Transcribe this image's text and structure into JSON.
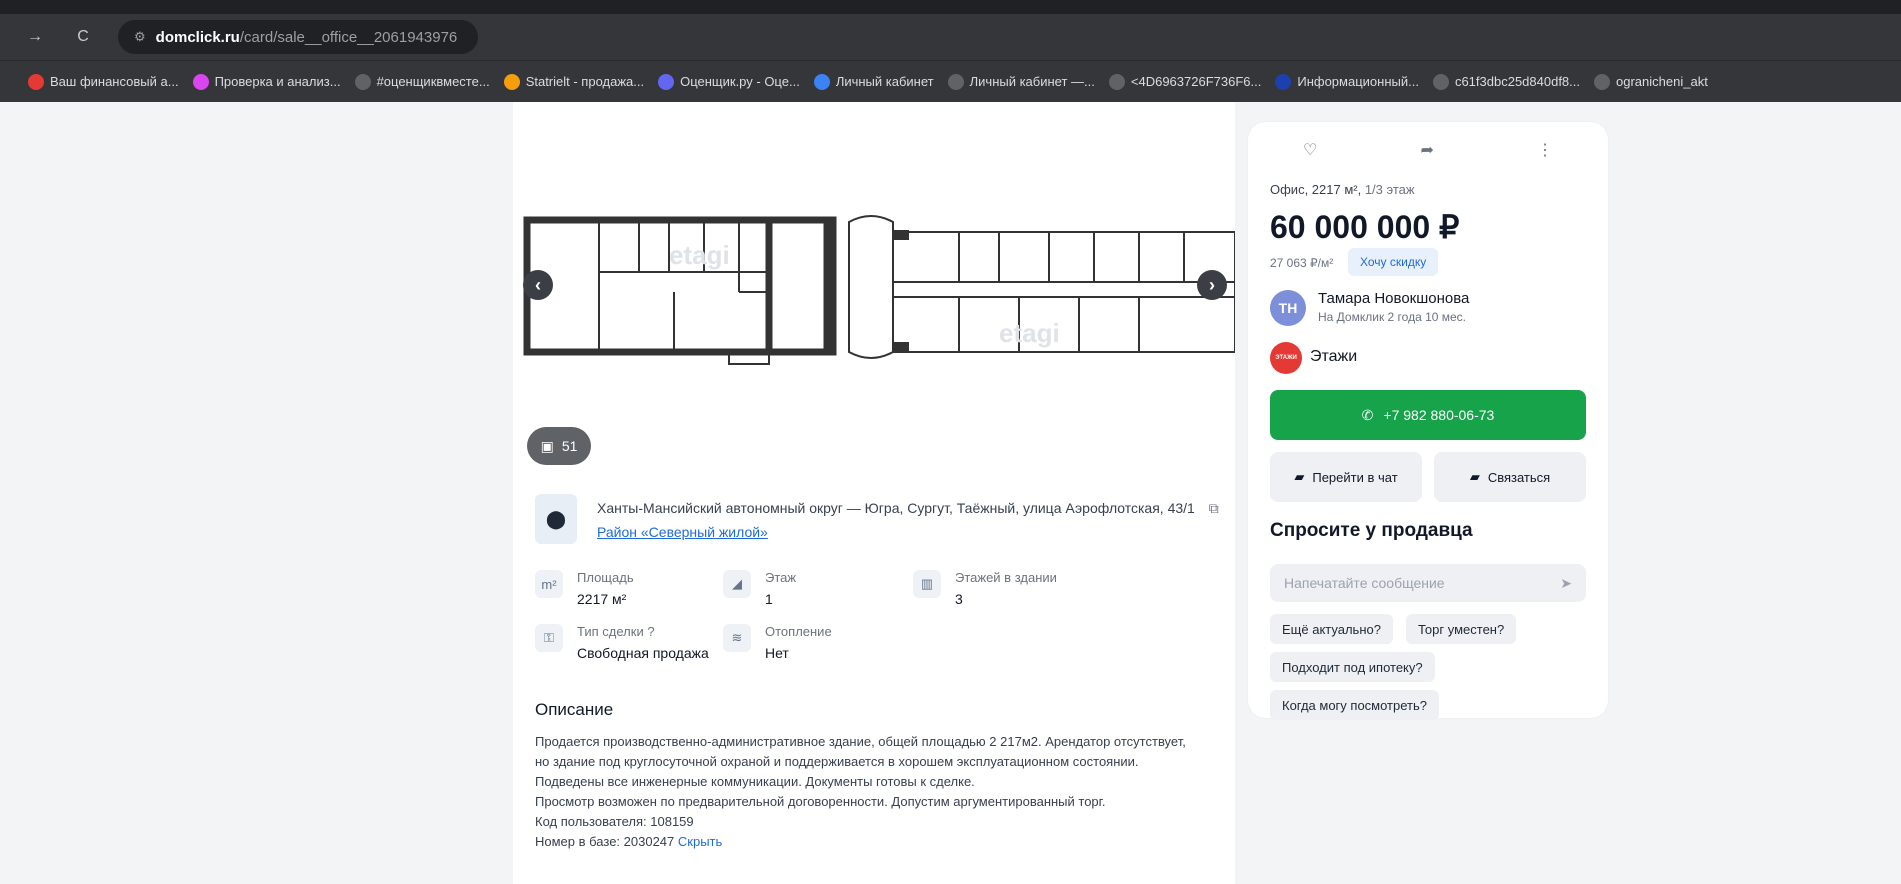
{
  "browser": {
    "url_host": "domclick.ru",
    "url_path": "/card/sale__office__2061943976",
    "bookmarks": [
      {
        "label": "Ваш финансовый а...",
        "color": "#e53935",
        "icon": "ri"
      },
      {
        "label": "Проверка и анализ...",
        "color": "#d946ef",
        "icon": "p"
      },
      {
        "label": "#оценщиквместе...",
        "color": "#5f6368",
        "icon": "globe"
      },
      {
        "label": "Statrielt - продажа...",
        "color": "#f59e0b",
        "icon": "st"
      },
      {
        "label": "Оценщик.ру - Оце...",
        "color": "#6366f1",
        "icon": "star"
      },
      {
        "label": "Личный кабинет",
        "color": "#3b82f6",
        "icon": "lk"
      },
      {
        "label": "Личный кабинет —...",
        "color": "#5f6368",
        "icon": "globe"
      },
      {
        "label": "<4D6963726F736F6...",
        "color": "#5f6368",
        "icon": "globe"
      },
      {
        "label": "Информационный...",
        "color": "#1e40af",
        "icon": "info"
      },
      {
        "label": "c61f3dbc25d840df8...",
        "color": "#5f6368",
        "icon": "globe"
      },
      {
        "label": "ogranicheni_akt",
        "color": "#5f6368",
        "icon": "globe"
      }
    ]
  },
  "gallery": {
    "photo_count": "51",
    "watermark": "etagi"
  },
  "location": {
    "address": "Ханты-Мансийский автономный округ — Югра, Сургут, Таёжный, улица Аэрофлотская, 43/1",
    "district": "Район «Северный жилой»"
  },
  "props": {
    "area_label": "Площадь",
    "area_value": "2217 м²",
    "floor_label": "Этаж",
    "floor_value": "1",
    "floors_label": "Этажей в здании",
    "floors_value": "3",
    "deal_label": "Тип сделки",
    "deal_value": "Свободная продажа",
    "heating_label": "Отопление",
    "heating_value": "Нет"
  },
  "description": {
    "title": "Описание",
    "line1": "Продается производственно-административное здание, общей площадью 2 217м2. Арендатор отсутствует, но здание под круглосуточной охраной и поддерживается в хорошем эксплуатационном состоянии.",
    "line2": "Подведены все инженерные коммуникации. Документы готовы к сделке.",
    "line3": "Просмотр возможен по предварительной договоренности. Допустим аргументированный торг.",
    "user_code": "Код пользователя: 108159",
    "base_number": "Номер в базе: 2030247",
    "hide_link": "Скрыть"
  },
  "offer": {
    "type": "Офис, 2217 м²,",
    "floor": "1/3 этаж",
    "price": "60 000 000 ₽",
    "price_per_m": "27 063 ₽/м²",
    "discount_button": "Хочу скидку"
  },
  "agent": {
    "initials": "ТН",
    "name": "Тамара Новокшонова",
    "tenure": "На Домклик 2 года 10 мес.",
    "agency": "Этажи",
    "agency_logo_text": "ЭТАЖИ"
  },
  "actions": {
    "phone": "+7 982 880-06-73",
    "chat": "Перейти в чат",
    "contact": "Связаться"
  },
  "ask": {
    "title": "Спросите у продавца",
    "placeholder": "Напечатайте сообщение",
    "chips": [
      "Ещё актуально?",
      "Торг уместен?",
      "Подходит под ипотеку?",
      "Когда могу посмотреть?"
    ]
  },
  "colors": {
    "call_green": "#16a34a",
    "link_blue": "#1f6bd6",
    "agency_red": "#e53935"
  }
}
